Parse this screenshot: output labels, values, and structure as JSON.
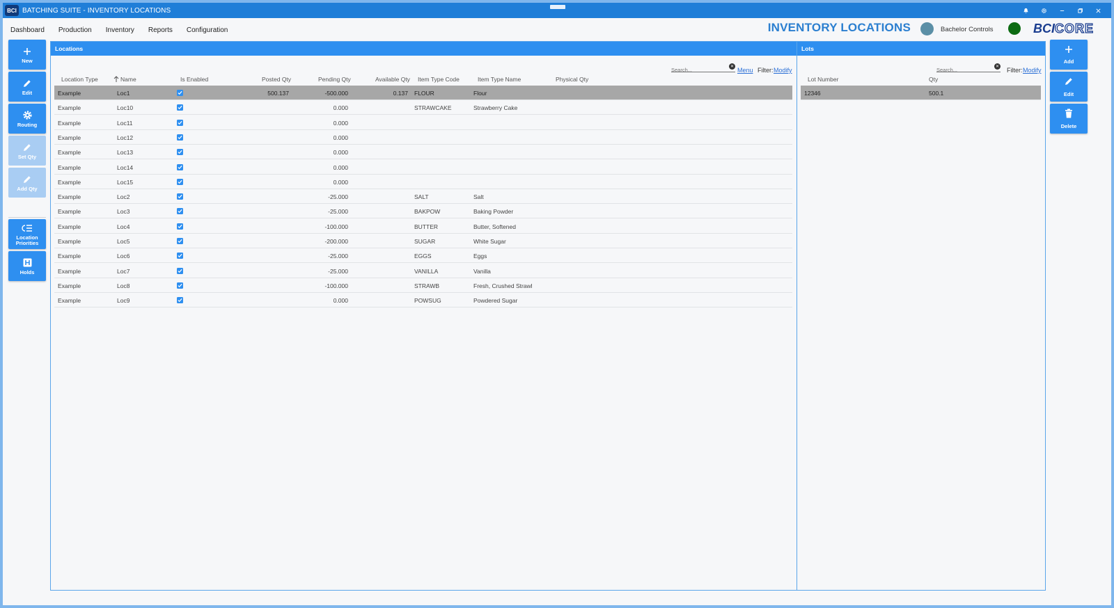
{
  "window": {
    "logo_text": "BCI",
    "title": "BATCHING SUITE - INVENTORY LOCATIONS"
  },
  "menu": [
    "Dashboard",
    "Production",
    "Inventory",
    "Reports",
    "Configuration"
  ],
  "header": {
    "page_title": "INVENTORY LOCATIONS",
    "user_name": "Bachelor Controls",
    "brand_prefix": "BCI",
    "brand_suffix": "CORE",
    "status_color": "#0c6b12"
  },
  "sidebar": {
    "new": "New",
    "edit": "Edit",
    "routing": "Routing",
    "set_qty": "Set Qty",
    "add_qty": "Add Qty",
    "location_priorities": "Location Priorities",
    "holds": "Holds"
  },
  "locations": {
    "panel_title": "Locations",
    "search_placeholder": "Search...",
    "menu_link": "Menu",
    "filter_label": "Filter:",
    "filter_link": "Modify",
    "columns": {
      "location_type": "Location Type",
      "name": "Name",
      "is_enabled": "Is Enabled",
      "posted_qty": "Posted Qty",
      "pending_qty": "Pending Qty",
      "available_qty": "Available Qty",
      "item_type_code": "Item Type Code",
      "item_type_name": "Item Type Name",
      "physical_qty": "Physical Qty"
    },
    "rows": [
      {
        "location_type": "Example",
        "name": "Loc1",
        "enabled": true,
        "posted": "500.137",
        "pending": "-500.000",
        "available": "0.137",
        "code": "FLOUR",
        "item_name": "Flour",
        "selected": true
      },
      {
        "location_type": "Example",
        "name": "Loc10",
        "enabled": true,
        "posted": "",
        "pending": "0.000",
        "available": "",
        "code": "STRAWCAKE",
        "item_name": "Strawberry Cake"
      },
      {
        "location_type": "Example",
        "name": "Loc11",
        "enabled": true,
        "posted": "",
        "pending": "0.000",
        "available": "",
        "code": "",
        "item_name": ""
      },
      {
        "location_type": "Example",
        "name": "Loc12",
        "enabled": true,
        "posted": "",
        "pending": "0.000",
        "available": "",
        "code": "",
        "item_name": ""
      },
      {
        "location_type": "Example",
        "name": "Loc13",
        "enabled": true,
        "posted": "",
        "pending": "0.000",
        "available": "",
        "code": "",
        "item_name": ""
      },
      {
        "location_type": "Example",
        "name": "Loc14",
        "enabled": true,
        "posted": "",
        "pending": "0.000",
        "available": "",
        "code": "",
        "item_name": ""
      },
      {
        "location_type": "Example",
        "name": "Loc15",
        "enabled": true,
        "posted": "",
        "pending": "0.000",
        "available": "",
        "code": "",
        "item_name": ""
      },
      {
        "location_type": "Example",
        "name": "Loc2",
        "enabled": true,
        "posted": "",
        "pending": "-25.000",
        "available": "",
        "code": "SALT",
        "item_name": "Salt"
      },
      {
        "location_type": "Example",
        "name": "Loc3",
        "enabled": true,
        "posted": "",
        "pending": "-25.000",
        "available": "",
        "code": "BAKPOW",
        "item_name": "Baking Powder"
      },
      {
        "location_type": "Example",
        "name": "Loc4",
        "enabled": true,
        "posted": "",
        "pending": "-100.000",
        "available": "",
        "code": "BUTTER",
        "item_name": "Butter, Softened"
      },
      {
        "location_type": "Example",
        "name": "Loc5",
        "enabled": true,
        "posted": "",
        "pending": "-200.000",
        "available": "",
        "code": "SUGAR",
        "item_name": "White Sugar"
      },
      {
        "location_type": "Example",
        "name": "Loc6",
        "enabled": true,
        "posted": "",
        "pending": "-25.000",
        "available": "",
        "code": "EGGS",
        "item_name": "Eggs"
      },
      {
        "location_type": "Example",
        "name": "Loc7",
        "enabled": true,
        "posted": "",
        "pending": "-25.000",
        "available": "",
        "code": "VANILLA",
        "item_name": "Vanilla"
      },
      {
        "location_type": "Example",
        "name": "Loc8",
        "enabled": true,
        "posted": "",
        "pending": "-100.000",
        "available": "",
        "code": "STRAWB",
        "item_name": "Fresh, Crushed Strawl"
      },
      {
        "location_type": "Example",
        "name": "Loc9",
        "enabled": true,
        "posted": "",
        "pending": "0.000",
        "available": "",
        "code": "POWSUG",
        "item_name": "Powdered Sugar"
      }
    ]
  },
  "lots": {
    "panel_title": "Lots",
    "search_placeholder": "Search...",
    "filter_label": "Filter:",
    "filter_link": "Modify",
    "columns": {
      "lot_number": "Lot Number",
      "qty": "Qty"
    },
    "rows": [
      {
        "lot_number": "12346",
        "qty": "500.1",
        "selected": true
      }
    ]
  },
  "right_actions": {
    "add": "Add",
    "edit": "Edit",
    "delete": "Delete"
  }
}
